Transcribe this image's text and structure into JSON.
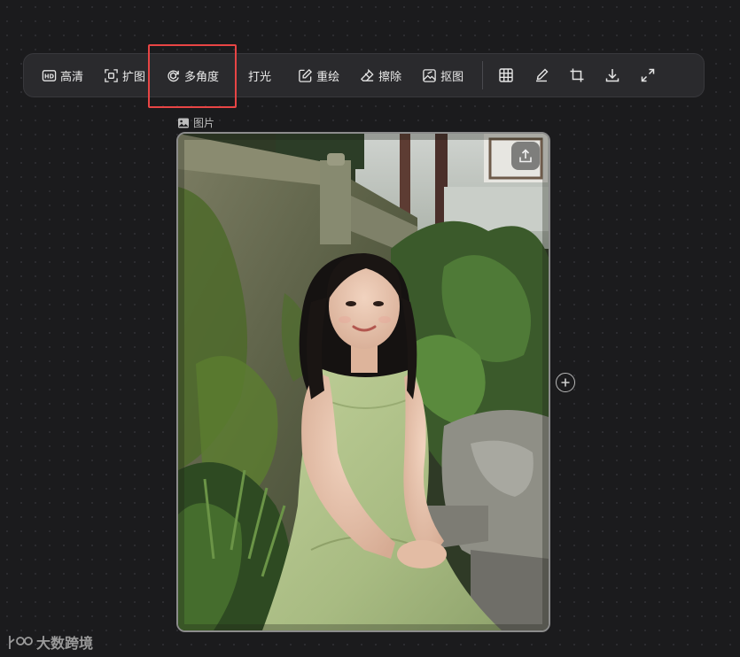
{
  "toolbar": {
    "items": [
      {
        "label": "高清",
        "icon": "hd-icon"
      },
      {
        "label": "扩图",
        "icon": "expand-icon"
      },
      {
        "label": "多角度",
        "icon": "rotate-angle-icon",
        "highlighted": true
      },
      {
        "label": "打光",
        "icon": null
      },
      {
        "label": "重绘",
        "icon": "edit-icon"
      },
      {
        "label": "擦除",
        "icon": "eraser-icon"
      },
      {
        "label": "抠图",
        "icon": "cutout-icon"
      }
    ],
    "icon_buttons": [
      "grid-icon",
      "brush-icon",
      "crop-icon",
      "download-icon",
      "fullscreen-icon"
    ]
  },
  "image_node": {
    "label": "图片",
    "label_icon": "image-icon",
    "upload_icon": "upload-icon",
    "add_icon": "plus-circle-icon"
  },
  "watermark": {
    "text": "大数跨境"
  },
  "colors": {
    "background": "#1b1b1d",
    "toolbar": "#2a2a2d",
    "highlight_border": "#e84545"
  }
}
